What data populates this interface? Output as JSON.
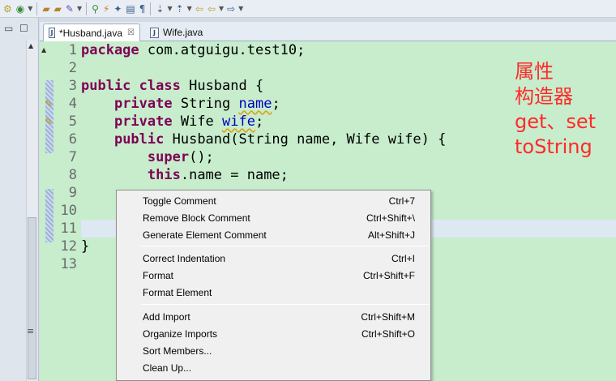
{
  "toolbar": {
    "icons": [
      "new-wizard-icon",
      "debug-icon",
      "open-folder-icon",
      "open-project-icon",
      "tools-icon",
      "search-icon",
      "build-icon",
      "refactor-icon",
      "open-task-icon",
      "format-icon",
      "next-annotation-icon",
      "prev-annotation-icon",
      "back-icon",
      "forward-icon"
    ]
  },
  "tabs": [
    {
      "label": "*Husband.java",
      "active": true,
      "close_glyph": "☒"
    },
    {
      "label": "Wife.java",
      "active": false
    }
  ],
  "editor": {
    "line_numbers": [
      "1",
      "2",
      "3",
      "4",
      "5",
      "6",
      "7",
      "8",
      "9",
      "10",
      "11",
      "12",
      "13"
    ],
    "warning_lines": [
      "4",
      "5"
    ],
    "highlighted_line": "11",
    "lines": [
      [
        {
          "t": "package",
          "c": "kw"
        },
        {
          "t": " com.atguigu.test10;",
          "c": ""
        }
      ],
      [],
      [
        {
          "t": "public",
          "c": "kw"
        },
        {
          "t": " ",
          "c": ""
        },
        {
          "t": "class",
          "c": "kw"
        },
        {
          "t": " Husband {",
          "c": ""
        }
      ],
      [
        {
          "t": "    ",
          "c": ""
        },
        {
          "t": "private",
          "c": "kw"
        },
        {
          "t": " String ",
          "c": ""
        },
        {
          "t": "name",
          "c": "fld warn"
        },
        {
          "t": ";",
          "c": ""
        }
      ],
      [
        {
          "t": "    ",
          "c": ""
        },
        {
          "t": "private",
          "c": "kw"
        },
        {
          "t": " Wife ",
          "c": ""
        },
        {
          "t": "wife",
          "c": "fld warn"
        },
        {
          "t": ";",
          "c": ""
        }
      ],
      [
        {
          "t": "    ",
          "c": ""
        },
        {
          "t": "public",
          "c": "kw"
        },
        {
          "t": " Husband(String name, Wife wife) {",
          "c": ""
        }
      ],
      [
        {
          "t": "        ",
          "c": ""
        },
        {
          "t": "super",
          "c": "kw"
        },
        {
          "t": "();",
          "c": ""
        }
      ],
      [
        {
          "t": "        ",
          "c": ""
        },
        {
          "t": "this",
          "c": "kw"
        },
        {
          "t": ".name = name;",
          "c": ""
        }
      ],
      [],
      [],
      [],
      [
        {
          "t": "}",
          "c": ""
        }
      ],
      []
    ]
  },
  "annotation": [
    "属性",
    "构造器",
    "get、set",
    "toString"
  ],
  "context_menu": {
    "groups": [
      [
        {
          "label": "Toggle Comment",
          "shortcut": "Ctrl+7"
        },
        {
          "label": "Remove Block Comment",
          "shortcut": "Ctrl+Shift+\\"
        },
        {
          "label": "Generate Element Comment",
          "shortcut": "Alt+Shift+J"
        }
      ],
      [
        {
          "label": "Correct Indentation",
          "shortcut": "Ctrl+I"
        },
        {
          "label": "Format",
          "shortcut": "Ctrl+Shift+F"
        },
        {
          "label": "Format Element",
          "shortcut": ""
        }
      ],
      [
        {
          "label": "Add Import",
          "shortcut": "Ctrl+Shift+M"
        },
        {
          "label": "Organize Imports",
          "shortcut": "Ctrl+Shift+O"
        },
        {
          "label": "Sort Members...",
          "shortcut": ""
        },
        {
          "label": "Clean Up...",
          "shortcut": ""
        }
      ]
    ]
  },
  "colors": {
    "editor_bg": "#c7edcc",
    "keyword": "#7f0055",
    "field": "#0000c0",
    "annotation": "#ff2a2a",
    "menu_bg": "#f0f0f0"
  }
}
